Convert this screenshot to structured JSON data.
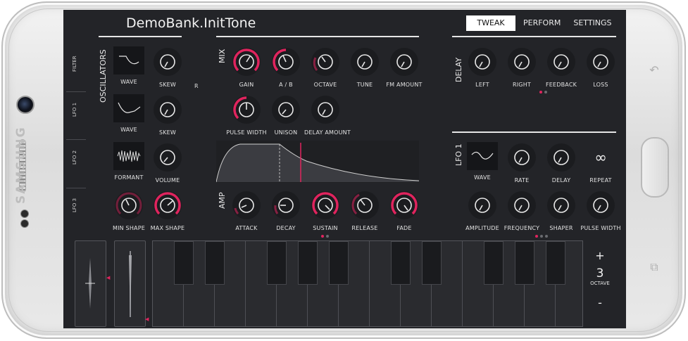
{
  "app": {
    "title": "DemoBank.InitTone",
    "nav": [
      "TWEAK",
      "PERFORM",
      "SETTINGS"
    ],
    "active_nav": "TWEAK"
  },
  "device": {
    "brand": "SAMSUNG"
  },
  "side_tabs": [
    "FILTER",
    "LFO 1",
    "LFO 2",
    "LFO 3"
  ],
  "oscillators": {
    "section": "OSCILLATORS",
    "r_label": "R",
    "rows": [
      {
        "tile_label": "WAVE",
        "knob_label": "SKEW"
      },
      {
        "tile_label": "WAVE",
        "knob_label": "SKEW"
      },
      {
        "tile_label": "FORMANT",
        "knob_label": "VOLUME"
      }
    ],
    "shape_knobs": [
      "MIN SHAPE",
      "MAX SHAPE"
    ]
  },
  "mix": {
    "section": "MIX",
    "row1": [
      "GAIN",
      "A / B",
      "OCTAVE",
      "TUNE",
      "FM AMOUNT"
    ],
    "row2": [
      "PULSE WIDTH",
      "UNISON",
      "DELAY AMOUNT"
    ]
  },
  "amp": {
    "section": "AMP",
    "knobs": [
      "ATTACK",
      "DECAY",
      "SUSTAIN",
      "RELEASE",
      "FADE"
    ]
  },
  "delay": {
    "section": "DELAY",
    "knobs": [
      "LEFT",
      "RIGHT",
      "FEEDBACK",
      "LOSS"
    ]
  },
  "lfo1": {
    "section": "LFO 1",
    "row1": [
      "WAVE",
      "RATE",
      "DELAY",
      "REPEAT"
    ],
    "repeat_symbol": "∞",
    "row2": [
      "AMPLITUDE",
      "FREQUENCY",
      "SHAPER",
      "PULSE WIDTH"
    ]
  },
  "keyboard": {
    "octave_up": "+",
    "octave_down": "-",
    "octave_value": "3",
    "octave_label": "OCTAVE"
  },
  "colors": {
    "accent": "#e0245e",
    "background": "#232428",
    "knob": "#1b1c1f",
    "text": "#e2e2e2"
  }
}
